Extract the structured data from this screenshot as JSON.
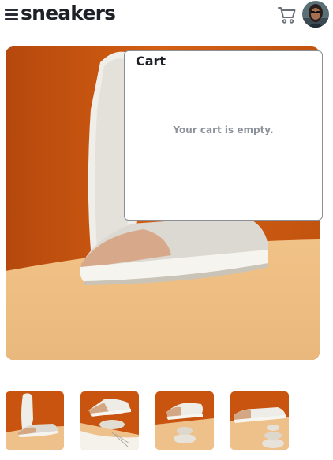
{
  "header": {
    "brand": "sneakers",
    "menu_icon": "menu-icon",
    "cart_icon": "cart-icon",
    "avatar_icon": "avatar-icon"
  },
  "product": {
    "hero_image": "product-image-1",
    "thumbnails": [
      {
        "image": "product-thumbnail-1"
      },
      {
        "image": "product-thumbnail-2"
      },
      {
        "image": "product-thumbnail-3"
      },
      {
        "image": "product-thumbnail-4"
      }
    ]
  },
  "cart": {
    "title": "Cart",
    "empty_message": "Your cart is empty."
  },
  "colors": {
    "orange": "#c2510f",
    "peach": "#eec08a",
    "dark_text": "#1d2026",
    "grey_text": "#8e929b"
  }
}
